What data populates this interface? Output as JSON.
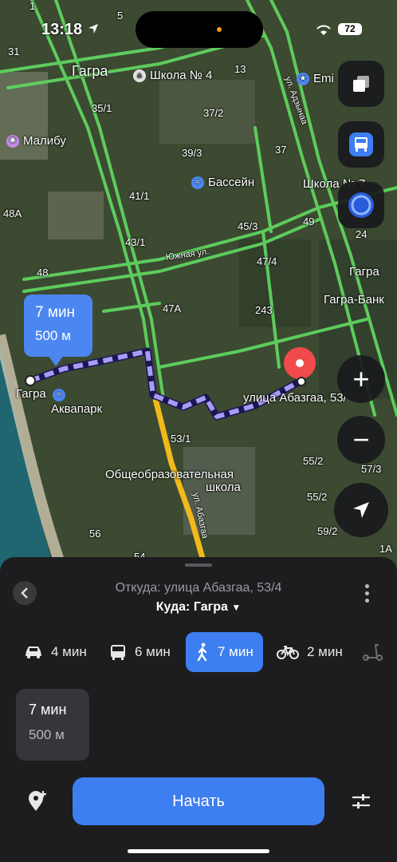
{
  "status": {
    "time": "13:18",
    "battery": "72"
  },
  "map": {
    "labels": {
      "gagra_city": "Гагра",
      "malibu": "Малибу",
      "school4": "Школа № 4",
      "emi": "Emi",
      "pool": "Бассейн",
      "school_right": "Школа № 7",
      "gagra_right": "Гагра",
      "gagra_bank": "Гагра-Банк",
      "aquapark": "Аквапарк",
      "gagra_start": "Гагра",
      "destination": "улица Абазгаа, 53/",
      "school_general": "Общеобразовательная",
      "school_general2": "школа",
      "street_yuzhnaya": "Южная ул.",
      "street_adzhaa": "ул. Адзынаа",
      "street_abazgaa": "ул. Абазгаа",
      "street_abazg2": "Абаз"
    },
    "numbers": [
      "31",
      "5",
      "1",
      "35/1",
      "37/2",
      "39/3",
      "41/1",
      "43/1",
      "45/3",
      "37",
      "47/4",
      "49",
      "24",
      "48",
      "48A",
      "47A",
      "243",
      "53/1",
      "55/2",
      "57/3",
      "59/2",
      "56",
      "54",
      "1A",
      "13"
    ],
    "route_bubble": {
      "time": "7 мин",
      "distance": "500 м"
    }
  },
  "controls": {
    "layers_icon": "layers-icon",
    "transport_icon": "bus-icon",
    "alice_icon": "alice-icon",
    "zoom_in": "+",
    "zoom_out": "−",
    "locate_icon": "navigation-arrow-icon"
  },
  "sheet": {
    "from": "Откуда: улица Абазгаа, 53/4",
    "to": "Куда: Гагра",
    "modes": [
      {
        "icon": "car-icon",
        "label": "4 мин"
      },
      {
        "icon": "bus-icon",
        "label": "6 мин"
      },
      {
        "icon": "walk-icon",
        "label": "7 мин"
      },
      {
        "icon": "bike-icon",
        "label": "2 мин"
      },
      {
        "icon": "scooter-icon",
        "label": ""
      }
    ],
    "card": {
      "time": "7 мин",
      "distance": "500 м"
    },
    "start_label": "Начать"
  },
  "colors": {
    "accent": "#3d7ef0",
    "route": "#a79cf7",
    "road": "#5fd35f",
    "destination": "#f04a4a"
  }
}
